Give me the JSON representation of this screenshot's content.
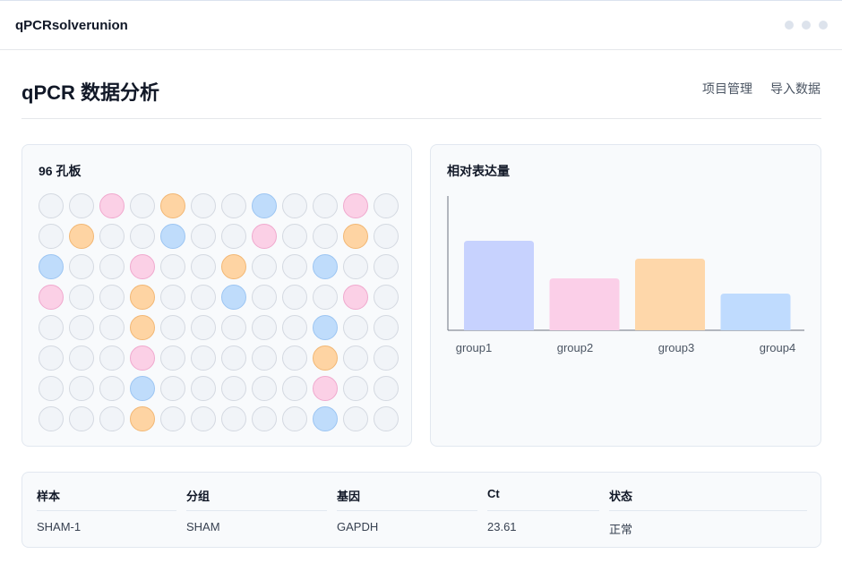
{
  "app": {
    "name": "qPCRsolverunion"
  },
  "header": {
    "title": "qPCR 数据分析",
    "nav": [
      "项目管理",
      "导入数据"
    ]
  },
  "plate": {
    "title": "96 孔板",
    "rows": [
      [
        0,
        0,
        2,
        0,
        3,
        0,
        0,
        1,
        0,
        0,
        2,
        0
      ],
      [
        0,
        3,
        0,
        0,
        1,
        0,
        0,
        2,
        0,
        0,
        3,
        0
      ],
      [
        1,
        0,
        0,
        2,
        0,
        0,
        3,
        0,
        0,
        1,
        0,
        0
      ],
      [
        2,
        0,
        0,
        3,
        0,
        0,
        1,
        0,
        0,
        0,
        2,
        0
      ],
      [
        0,
        0,
        0,
        3,
        0,
        0,
        0,
        0,
        0,
        1,
        0,
        0
      ],
      [
        0,
        0,
        0,
        2,
        0,
        0,
        0,
        0,
        0,
        3,
        0,
        0
      ],
      [
        0,
        0,
        0,
        1,
        0,
        0,
        0,
        0,
        0,
        2,
        0,
        0
      ],
      [
        0,
        0,
        0,
        3,
        0,
        0,
        0,
        0,
        0,
        1,
        0,
        0
      ]
    ],
    "colors": {
      "0": "#f1f4f8",
      "1": "#bfdcfb",
      "2": "#fbd0e6",
      "3": "#fed4a3"
    }
  },
  "chart": {
    "title": "相对表达量"
  },
  "chart_data": {
    "type": "bar",
    "title": "相对表达量",
    "categories": [
      "group1",
      "group2",
      "group3",
      "group4"
    ],
    "values": [
      1.0,
      0.58,
      0.8,
      0.41
    ],
    "colors": [
      "#c7d2fe",
      "#fbcfe8",
      "#fed7aa",
      "#bfdbfe"
    ],
    "ylim": [
      0,
      1.5
    ],
    "xlabel": "",
    "ylabel": ""
  },
  "table": {
    "columns": [
      "样本",
      "分组",
      "基因",
      "Ct",
      "状态"
    ],
    "rows": [
      [
        "SHAM-1",
        "SHAM",
        "GAPDH",
        "23.61",
        "正常"
      ]
    ]
  }
}
